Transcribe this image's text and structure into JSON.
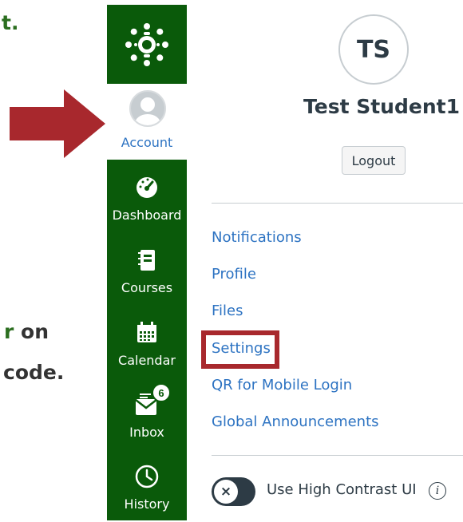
{
  "instructions": {
    "fragment_1": "t.",
    "fragment_2_highlight": "r",
    "fragment_2_rest": " on",
    "fragment_3": "code."
  },
  "nav": {
    "account_label": "Account",
    "items": [
      {
        "label": "Dashboard",
        "icon": "dashboard-icon"
      },
      {
        "label": "Courses",
        "icon": "courses-icon"
      },
      {
        "label": "Calendar",
        "icon": "calendar-icon"
      },
      {
        "label": "Inbox",
        "icon": "inbox-icon",
        "badge": "6"
      },
      {
        "label": "History",
        "icon": "history-icon"
      }
    ]
  },
  "tray": {
    "initials": "TS",
    "student_name": "Test Student1",
    "logout_label": "Logout",
    "links": [
      "Notifications",
      "Profile",
      "Files",
      "Settings",
      "QR for Mobile Login",
      "Global Announcements"
    ],
    "high_contrast_label": "Use High Contrast UI",
    "toggle_glyph": "×",
    "info_glyph": "i"
  },
  "colors": {
    "nav_green": "#0a5a0a",
    "link_blue": "#2d73c2",
    "highlight_red": "#a8282d",
    "text_dark": "#2d3b45"
  }
}
